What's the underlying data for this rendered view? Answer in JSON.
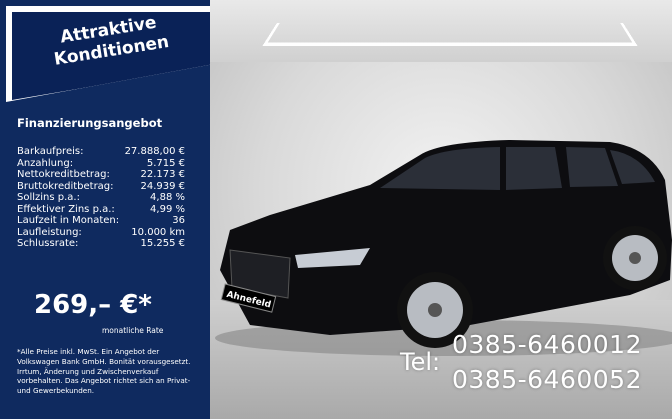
{
  "panel": {
    "headline": [
      "Attraktive",
      "Konditionen"
    ],
    "section_title": "Finanzierungsangebot",
    "rows": [
      {
        "label": "Barkaufpreis:",
        "value": "27.888,00 €"
      },
      {
        "label": "Anzahlung:",
        "value": "5.715 €"
      },
      {
        "label": "Nettokreditbetrag:",
        "value": "22.173 €"
      },
      {
        "label": "Bruttokreditbetrag:",
        "value": "24.939 €"
      },
      {
        "label": "Sollzins p.a.:",
        "value": "4,88 %"
      },
      {
        "label": "Effektiver Zins p.a.:",
        "value": "4,99 %"
      },
      {
        "label": "Laufzeit in Monaten:",
        "value": "36"
      },
      {
        "label": "Laufleistung:",
        "value": "10.000 km"
      },
      {
        "label": "Schlussrate:",
        "value": "15.255 €"
      }
    ],
    "rate": "269,– €*",
    "rate_label": "monatliche Rate",
    "disclaimer": "*Alle Preise inkl. MwSt. Ein Angebot der Volkswagen Bank GmbH. Bonität vorausgesetzt. Irrtum, Änderung und Zwischenverkauf vorbehalten. Das Angebot richtet sich an Privat- und Gewerbekunden."
  },
  "photo": {
    "plate_text": "Ahnefeld"
  },
  "phone": {
    "label": "Tel:",
    "numbers": [
      "0385-6460012",
      "0385-6460052"
    ]
  },
  "colors": {
    "panel": "#0f2a5f",
    "car": "#0d0d10"
  }
}
